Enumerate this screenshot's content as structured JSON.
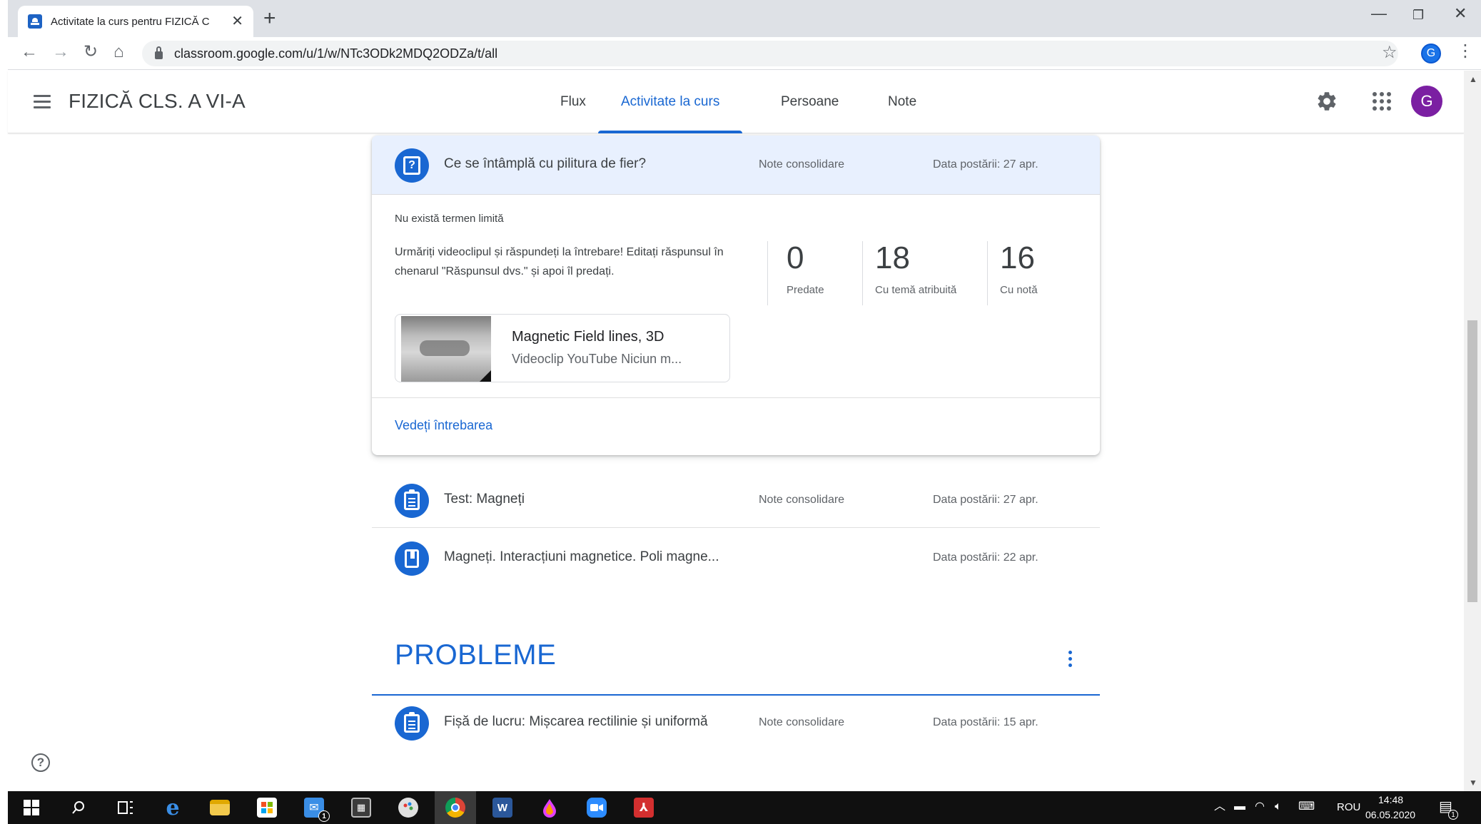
{
  "browser": {
    "tab_title": "Activitate la curs pentru FIZICĂ C",
    "tab_close": "✕",
    "new_tab": "+",
    "url": "classroom.google.com/u/1/w/NTc3ODk2MDQ2ODZa/t/all",
    "profile_initial": "G",
    "window_controls": {
      "minimize": "—",
      "restore": "❐",
      "close": "✕"
    },
    "nav": {
      "back": "←",
      "forward": "→",
      "reload": "↻",
      "home": "⌂",
      "star": "☆",
      "menu": "⋮"
    }
  },
  "header": {
    "class_title": "FIZICĂ CLS. A VI-A",
    "tabs": [
      {
        "label": "Flux"
      },
      {
        "label": "Activitate la curs"
      },
      {
        "label": "Persoane"
      },
      {
        "label": "Note"
      }
    ],
    "active_tab": "Activitate la curs",
    "avatar_initial": "G",
    "accent_color": "#1967d2",
    "avatar_color": "#7b1fa2"
  },
  "expanded_item": {
    "title": "Ce se întâmplă cu pilitura de fier?",
    "topic": "Note consolidare",
    "date": "Data postării: 27 apr.",
    "due": "Nu există termen limită",
    "instructions": "Urmăriți videoclipul și răspundeți la întrebare! Editați răspunsul în chenarul \"Răspunsul dvs.\" și apoi îl predați.",
    "stats": [
      {
        "value": "0",
        "label": "Predate"
      },
      {
        "value": "18",
        "label": "Cu temă atribuită"
      },
      {
        "value": "16",
        "label": "Cu notă"
      }
    ],
    "attachment": {
      "title": "Magnetic Field lines, 3D",
      "subtitle": "Videoclip YouTube   Niciun m..."
    },
    "view_link": "Vedeți întrebarea"
  },
  "items": [
    {
      "title": "Test: Magneți",
      "topic": "Note consolidare",
      "date": "Data postării: 27 apr.",
      "icon": "assignment-icon"
    },
    {
      "title": "Magneți. Interacțiuni magnetice. Poli magne...",
      "topic": "",
      "date": "Data postării: 22 apr.",
      "icon": "material-icon"
    }
  ],
  "section": {
    "title": "PROBLEME",
    "items": [
      {
        "title": "Fișă de lucru: Mișcarea rectilinie și uniformă",
        "topic": "Note consolidare",
        "date": "Data postării: 15 apr.",
        "icon": "assignment-icon"
      }
    ]
  },
  "help_icon": "?",
  "taskbar": {
    "language": "ROU",
    "time": "14:48",
    "date": "06.05.2020",
    "mail_badge": "1",
    "notif_badge": "1"
  }
}
